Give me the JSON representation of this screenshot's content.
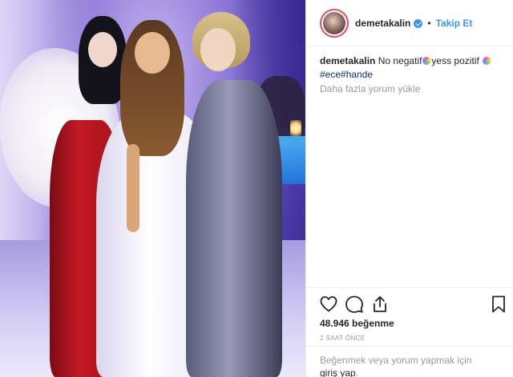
{
  "post": {
    "image_alt": "Photo of three women at an evening event",
    "author": {
      "username": "demetakalin",
      "verified": true,
      "follow_label": "Takip Et",
      "separator": "•"
    },
    "caption": {
      "username": "demetakalin",
      "text_part1": "No negatif",
      "text_part2": "yess pozitif",
      "hashtags": "#ece#hande"
    },
    "load_more_comments": "Daha fazla yorum yükle",
    "likes": "48.946 beğenme",
    "timestamp": "2 SAAT ÖNCE",
    "login_prompt": {
      "text": "Beğenmek veya yorum yapmak için",
      "link": "giriş yap",
      "suffix": "."
    }
  },
  "icons": {
    "like": "heart-icon",
    "comment": "comment-icon",
    "share": "share-icon",
    "save": "bookmark-icon",
    "emoji": "sparkle-emoji"
  },
  "colors": {
    "accent_blue": "#3897f0",
    "hashtag": "#003569",
    "muted": "#999999",
    "avatar_ring": "#e04a6a"
  }
}
